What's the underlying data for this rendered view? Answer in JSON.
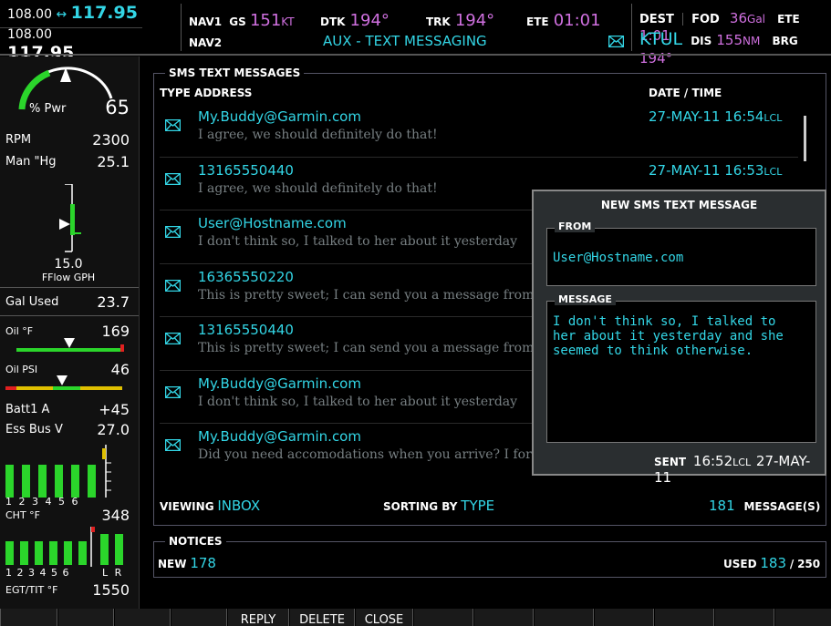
{
  "colors": {
    "cyan": "#33d6e6",
    "magenta": "#d070e0",
    "green": "#2bd52b",
    "panel_bg": "#000000",
    "popup_bg": "#2a2e30"
  },
  "com": {
    "active1": "108.00",
    "arrow": "↔",
    "standby1": "117.95",
    "active2": "108.00",
    "standby2": "117.95"
  },
  "nav": {
    "nav1_label": "NAV1",
    "nav2_label": "NAV2",
    "gs_label": "GS",
    "gs_value": "151",
    "gs_unit": "KT",
    "dtk_label": "DTK",
    "dtk_value": "194°",
    "trk_label": "TRK",
    "trk_value": "194°",
    "ete_label": "ETE",
    "ete_value": "01:01",
    "page_title": "AUX - TEXT MESSAGING"
  },
  "dest": {
    "dest_label": "DEST",
    "dest_value": "FOD",
    "fuel_value": "36",
    "fuel_unit": "Gal",
    "ete_label": "ETE",
    "ete_value": "1:01",
    "waypoint": "KTUL",
    "dis_label": "DIS",
    "dis_value": "155",
    "dis_unit": "NM",
    "brg_label": "BRG",
    "brg_value": "194°"
  },
  "eis": {
    "pwr_label": "% Pwr",
    "pwr_value": "65",
    "rpm_label": "RPM",
    "rpm_value": "2300",
    "man_label": "Man \"Hg",
    "man_value": "25.1",
    "fflow_value": "15.0",
    "fflow_label": "FFlow GPH",
    "galused_label": "Gal Used",
    "galused_value": "23.7",
    "oilt_label": "Oil °F",
    "oilt_value": "169",
    "oilp_label": "Oil PSI",
    "oilp_value": "46",
    "batt_label": "Batt1 A",
    "batt_value": "+45",
    "essbus_label": "Ess Bus V",
    "essbus_value": "27.0",
    "cht_cyls": "1 2 3 4 5 6",
    "cht_label": "CHT °F",
    "cht_value": "348",
    "egt_cyls": "1 2 3 4 5 6",
    "egt_lr": "L R",
    "egt_label": "EGT/TIT °F",
    "egt_value": "1550"
  },
  "sms": {
    "section_title": "SMS TEXT MESSAGES",
    "col_type_address": "TYPE ADDRESS",
    "col_datetime": "DATE / TIME",
    "messages": [
      {
        "address": "My.Buddy@Garmin.com",
        "preview": "I agree, we should definitely do that!",
        "date": "27-MAY-11 16:54",
        "tz": "LCL"
      },
      {
        "address": "13165550440",
        "preview": "I agree, we should definitely do that!",
        "date": "27-MAY-11 16:53",
        "tz": "LCL"
      },
      {
        "address": "User@Hostname.com",
        "preview": "I don't think so, I talked to her about it yesterday",
        "date": "",
        "tz": ""
      },
      {
        "address": "16365550220",
        "preview": "This is pretty sweet; I can send you a message from",
        "date": "",
        "tz": ""
      },
      {
        "address": "13165550440",
        "preview": "This is pretty sweet; I can send you a message from",
        "date": "",
        "tz": ""
      },
      {
        "address": "My.Buddy@Garmin.com",
        "preview": "I don't think so, I talked to her about it yesterday",
        "date": "",
        "tz": ""
      },
      {
        "address": "My.Buddy@Garmin.com",
        "preview": "Did you need accomodations when you arrive? I forgot",
        "date": "",
        "tz": ""
      }
    ],
    "viewing_label": "VIEWING",
    "viewing_value": "INBOX",
    "sorting_label": "SORTING BY",
    "sorting_value": "TYPE",
    "count_value": "181",
    "count_label": "MESSAGE(S)"
  },
  "popup": {
    "title": "NEW SMS TEXT MESSAGE",
    "from_label": "FROM",
    "from_value": "User@Hostname.com",
    "message_label": "MESSAGE",
    "message_line1": "I don't think so, I talked to",
    "message_line2": "her about it yesterday and she",
    "message_line3": "seemed to think otherwise.",
    "sent_label": "SENT",
    "sent_time": "16:52",
    "sent_tz": "LCL",
    "sent_date": "27-MAY-11"
  },
  "notices": {
    "title": "NOTICES",
    "new_label": "NEW",
    "new_value": "178",
    "used_label": "USED",
    "used_value": "183",
    "used_sep": "/",
    "used_total": "250"
  },
  "softkeys": {
    "reply": "REPLY",
    "delete": "DELETE",
    "close": "CLOSE"
  }
}
